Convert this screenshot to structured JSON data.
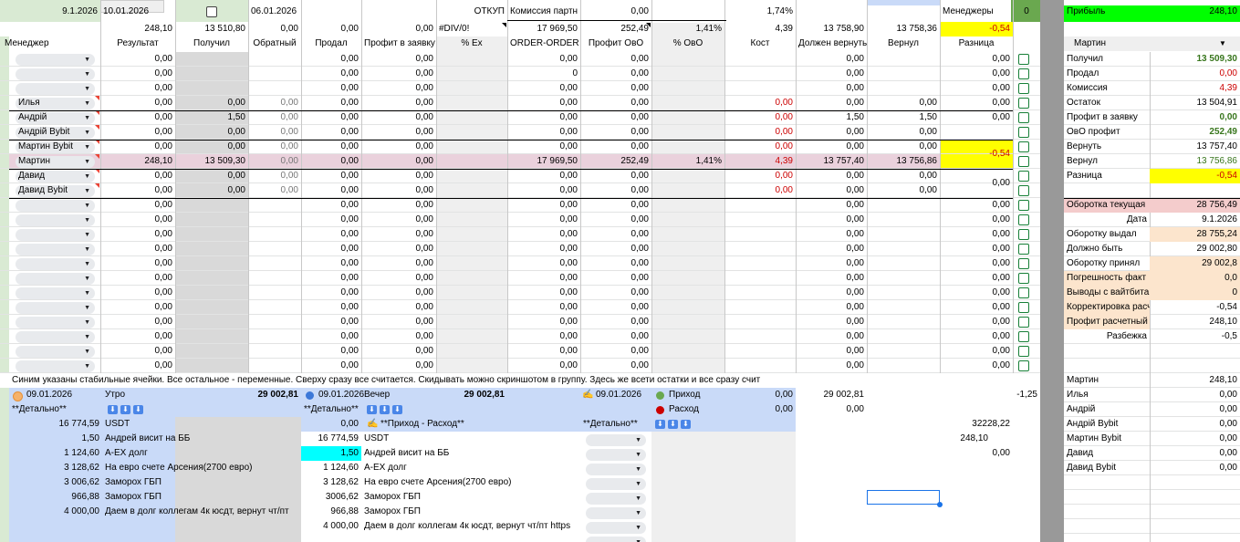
{
  "top": {
    "date1": "9.1.2026",
    "date2": "10.01.2026",
    "date3": "06.01.2026",
    "otkup": "ОТКУП",
    "komissiya_label": "Комиссия партн",
    "komissiya_val": "0,00",
    "pct": "1,74%",
    "managers_label": "Менеджеры",
    "managers_val": "0",
    "profit_label": "Прибыль",
    "profit_val": "248,10"
  },
  "totals": [
    "248,10",
    "13 510,80",
    "0,00",
    "0,00",
    "0,00",
    "#DIV/0!",
    "17 969,50",
    "252,49",
    "1,41%",
    "4,39",
    "13 758,90",
    "13 758,36",
    "-0,54"
  ],
  "headers": [
    "Менеджер",
    "Результат",
    "Получил",
    "Обратный",
    "Продал",
    "Профит в заявку",
    "% Ex",
    "ORDER-ORDER",
    "Профит ОвО",
    "% ОвО",
    "Кост",
    "Должен вернуть",
    "Вернул",
    "Разница"
  ],
  "rows": [
    {
      "m": "",
      "res": "0,00",
      "pol": "",
      "obr": "",
      "prod": "0,00",
      "prof": "0,00",
      "oo": "0,00",
      "ovo": "0,00",
      "pct": "",
      "kost": "",
      "dolzh": "0,00",
      "vern": "",
      "raz": "0,00"
    },
    {
      "m": "",
      "res": "0,00",
      "pol": "",
      "obr": "",
      "prod": "0,00",
      "prof": "0,00",
      "oo": "0",
      "ovo": "0,00",
      "pct": "",
      "kost": "",
      "dolzh": "0,00",
      "vern": "",
      "raz": "0,00"
    },
    {
      "m": "",
      "res": "0,00",
      "pol": "",
      "obr": "",
      "prod": "0,00",
      "prof": "0,00",
      "oo": "0,00",
      "ovo": "0,00",
      "pct": "",
      "kost": "",
      "dolzh": "0,00",
      "vern": "",
      "raz": "0,00"
    },
    {
      "m": "Илья",
      "res": "0,00",
      "pol": "0,00",
      "obr": "0,00",
      "prod": "0,00",
      "prof": "0,00",
      "oo": "0,00",
      "ovo": "0,00",
      "pct": "",
      "kost": "0,00",
      "dolzh": "0,00",
      "vern": "0,00",
      "raz": "0,00"
    },
    {
      "m": "Андрій",
      "res": "0,00",
      "pol": "1,50",
      "obr": "0,00",
      "prod": "0,00",
      "prof": "0,00",
      "oo": "0,00",
      "ovo": "0,00",
      "pct": "",
      "kost": "0,00",
      "dolzh": "1,50",
      "vern": "1,50",
      "raz": "0,00"
    },
    {
      "m": "Андрій Bybit",
      "res": "0,00",
      "pol": "0,00",
      "obr": "0,00",
      "prod": "0,00",
      "prof": "0,00",
      "oo": "0,00",
      "ovo": "0,00",
      "pct": "",
      "kost": "0,00",
      "dolzh": "0,00",
      "vern": "0,00",
      "raz": ""
    },
    {
      "m": "Мартин Bybit",
      "res": "0,00",
      "pol": "0,00",
      "obr": "0,00",
      "prod": "0,00",
      "prof": "0,00",
      "oo": "0,00",
      "ovo": "0,00",
      "pct": "",
      "kost": "0,00",
      "dolzh": "0,00",
      "vern": "0,00",
      "raz": ""
    },
    {
      "m": "Мартин",
      "res": "248,10",
      "pol": "13 509,30",
      "obr": "0,00",
      "prod": "0,00",
      "prof": "0,00",
      "oo": "17 969,50",
      "ovo": "252,49",
      "pct": "1,41%",
      "kost": "4,39",
      "dolzh": "13 757,40",
      "vern": "13 756,86",
      "raz": ""
    },
    {
      "m": "Давид",
      "res": "0,00",
      "pol": "0,00",
      "obr": "0,00",
      "prod": "0,00",
      "prof": "0,00",
      "oo": "0,00",
      "ovo": "0,00",
      "pct": "",
      "kost": "0,00",
      "dolzh": "0,00",
      "vern": "0,00",
      "raz": ""
    },
    {
      "m": "Давид Bybit",
      "res": "0,00",
      "pol": "0,00",
      "obr": "0,00",
      "prod": "0,00",
      "prof": "0,00",
      "oo": "0,00",
      "ovo": "0,00",
      "pct": "",
      "kost": "0,00",
      "dolzh": "0,00",
      "vern": "0,00",
      "raz": ""
    },
    {
      "m": "",
      "res": "0,00",
      "pol": "",
      "obr": "",
      "prod": "0,00",
      "prof": "0,00",
      "oo": "0,00",
      "ovo": "0,00",
      "pct": "",
      "kost": "",
      "dolzh": "0,00",
      "vern": "",
      "raz": "0,00"
    },
    {
      "m": "",
      "res": "0,00",
      "pol": "",
      "obr": "",
      "prod": "0,00",
      "prof": "0,00",
      "oo": "0,00",
      "ovo": "0,00",
      "pct": "",
      "kost": "",
      "dolzh": "0,00",
      "vern": "",
      "raz": "0,00"
    },
    {
      "m": "",
      "res": "0,00",
      "pol": "",
      "obr": "",
      "prod": "0,00",
      "prof": "0,00",
      "oo": "0,00",
      "ovo": "0,00",
      "pct": "",
      "kost": "",
      "dolzh": "0,00",
      "vern": "",
      "raz": "0,00"
    },
    {
      "m": "",
      "res": "0,00",
      "pol": "",
      "obr": "",
      "prod": "0,00",
      "prof": "0,00",
      "oo": "0,00",
      "ovo": "0,00",
      "pct": "",
      "kost": "",
      "dolzh": "0,00",
      "vern": "",
      "raz": "0,00"
    },
    {
      "m": "",
      "res": "0,00",
      "pol": "",
      "obr": "",
      "prod": "0,00",
      "prof": "0,00",
      "oo": "0,00",
      "ovo": "0,00",
      "pct": "",
      "kost": "",
      "dolzh": "0,00",
      "vern": "",
      "raz": "0,00"
    },
    {
      "m": "",
      "res": "0,00",
      "pol": "",
      "obr": "",
      "prod": "0,00",
      "prof": "0,00",
      "oo": "0,00",
      "ovo": "0,00",
      "pct": "",
      "kost": "",
      "dolzh": "0,00",
      "vern": "",
      "raz": "0,00"
    },
    {
      "m": "",
      "res": "0,00",
      "pol": "",
      "obr": "",
      "prod": "0,00",
      "prof": "0,00",
      "oo": "0,00",
      "ovo": "0,00",
      "pct": "",
      "kost": "",
      "dolzh": "0,00",
      "vern": "",
      "raz": "0,00"
    },
    {
      "m": "",
      "res": "0,00",
      "pol": "",
      "obr": "",
      "prod": "0,00",
      "prof": "0,00",
      "oo": "0,00",
      "ovo": "0,00",
      "pct": "",
      "kost": "",
      "dolzh": "0,00",
      "vern": "",
      "raz": "0,00"
    },
    {
      "m": "",
      "res": "0,00",
      "pol": "",
      "obr": "",
      "prod": "0,00",
      "prof": "0,00",
      "oo": "0,00",
      "ovo": "0,00",
      "pct": "",
      "kost": "",
      "dolzh": "0,00",
      "vern": "",
      "raz": "0,00"
    },
    {
      "m": "",
      "res": "0,00",
      "pol": "",
      "obr": "",
      "prod": "0,00",
      "prof": "0,00",
      "oo": "0,00",
      "ovo": "0,00",
      "pct": "",
      "kost": "",
      "dolzh": "0,00",
      "vern": "",
      "raz": "0,00"
    },
    {
      "m": "",
      "res": "0,00",
      "pol": "",
      "obr": "",
      "prod": "0,00",
      "prof": "0,00",
      "oo": "0,00",
      "ovo": "0,00",
      "pct": "",
      "kost": "",
      "dolzh": "0,00",
      "vern": "",
      "raz": "0,00"
    },
    {
      "m": "",
      "res": "0,00",
      "pol": "",
      "obr": "",
      "prod": "0,00",
      "prof": "0,00",
      "oo": "0,00",
      "ovo": "0,00",
      "pct": "",
      "kost": "",
      "dolzh": "0,00",
      "vern": "",
      "raz": "0,00"
    }
  ],
  "merged_raz": "-0,54",
  "merged_raz2": "0,00",
  "panel": {
    "dropdown": "Мартин",
    "items": [
      {
        "label": "Получил",
        "value": "13 509,30",
        "cls": "green b"
      },
      {
        "label": "Продал",
        "value": "0,00",
        "cls": "red"
      },
      {
        "label": "Комиссия",
        "value": "4,39",
        "cls": "red"
      },
      {
        "label": "Остаток",
        "value": "13 504,91",
        "cls": ""
      },
      {
        "label": "Профит в заявку",
        "value": "0,00",
        "cls": "green b"
      },
      {
        "label": "ОвО профит",
        "value": "252,49",
        "cls": "green b"
      },
      {
        "label": "Вернуть",
        "value": "13 757,40",
        "cls": ""
      },
      {
        "label": "Вернул",
        "value": "13 756,86",
        "cls": "green"
      },
      {
        "label": "Разница",
        "value": "-0,54",
        "cls": "yel"
      }
    ],
    "items2": [
      {
        "label": "Оборотка текущая",
        "value": "28 756,49",
        "bg": "#f4cccc"
      },
      {
        "label": "Дата",
        "value": "9.1.2026",
        "bg": "",
        "rlabel": true
      },
      {
        "label": "Оборотку выдал",
        "value": "28 755,24",
        "bg": "#fce5cd"
      },
      {
        "label": "Должно быть",
        "value": "29 002,80",
        "bg": ""
      },
      {
        "label": "Оборотку принял",
        "value": "29 002,8",
        "bg": "#fce5cd"
      },
      {
        "label": "Погрешность факт",
        "value": "0,0",
        "bg": "#fce5cd",
        "lbg": true
      },
      {
        "label": "Выводы с вайтбита",
        "value": "0",
        "bg": "#fce5cd",
        "lbg": true
      },
      {
        "label": "Корректировка расчет",
        "value": "-0,54",
        "bg": "",
        "lbg": true
      },
      {
        "label": "Профит расчетный",
        "value": "248,10",
        "bg": "",
        "lbg": true
      },
      {
        "label": "Разбежка",
        "value": "-0,5",
        "bg": "",
        "rlabel": true
      }
    ],
    "managers": [
      {
        "label": "Мартин",
        "value": "248,10"
      },
      {
        "label": "Илья",
        "value": "0,00"
      },
      {
        "label": "Андрій",
        "value": "0,00"
      },
      {
        "label": "Андрій Bybit",
        "value": "0,00"
      },
      {
        "label": "Мартин Bybit",
        "value": "0,00"
      },
      {
        "label": "Давид",
        "value": "0,00"
      },
      {
        "label": "Давид Bybit",
        "value": "0,00"
      }
    ]
  },
  "notice": "Синим указаны стабильные ячейки. Все остальное - переменные. Сверху сразу все считается. Скидывать можно скриншотом в группу. Здесь же всети остатки и все сразу счит",
  "bottom": {
    "morning": {
      "date": "09.01.2026",
      "label": "Утро",
      "total": "29 002,81",
      "detail": "**Детально**",
      "usdt_val": "16 774,59",
      "usdt": "USDT"
    },
    "evening": {
      "date": "09.01.2026",
      "label": "Вечер",
      "total": "29 002,81",
      "detail": "**Детально**",
      "usdt_val": "0,00",
      "flow": "**Приход - Расход**"
    },
    "income": {
      "date": "09.01.2026",
      "in_label": "Приход",
      "in_val": "0,00",
      "out_label": "Расход",
      "out_val": "0,00",
      "detail": "**Детально**",
      "val1": "29 002,81",
      "val2": "0,00",
      "val3": "-1,25",
      "val4": "32228,22",
      "val5": "248,10",
      "val6": "0,00"
    },
    "morning_rows": [
      {
        "v": "1,50",
        "t": "Андрей висит на ББ"
      },
      {
        "v": "1 124,60",
        "t": "A-EX долг"
      },
      {
        "v": "3 128,62",
        "t": "На евро счете Арсения(2700 евро)"
      },
      {
        "v": "3 006,62",
        "t": "Заморох ГБП"
      },
      {
        "v": "966,88",
        "t": "Заморох ГБП"
      },
      {
        "v": "4 000,00",
        "t": "Даем в долг коллегам 4к юсдт, вернут чт/пт"
      }
    ],
    "evening_rows": [
      {
        "v": "16 774,59",
        "t": "USDT"
      },
      {
        "v": "1,50",
        "t": "Андрей висит на ББ"
      },
      {
        "v": "1 124,60",
        "t": "A-EX долг"
      },
      {
        "v": "3 128,62",
        "t": "На евро счете Арсения(2700 евро)"
      },
      {
        "v": "3006,62",
        "t": "Заморох ГБП"
      },
      {
        "v": "966,88",
        "t": "Заморох ГБП"
      },
      {
        "v": "4 000,00",
        "t": "Даем в долг коллегам 4к юсдт, вернут чт/пт https"
      }
    ]
  }
}
